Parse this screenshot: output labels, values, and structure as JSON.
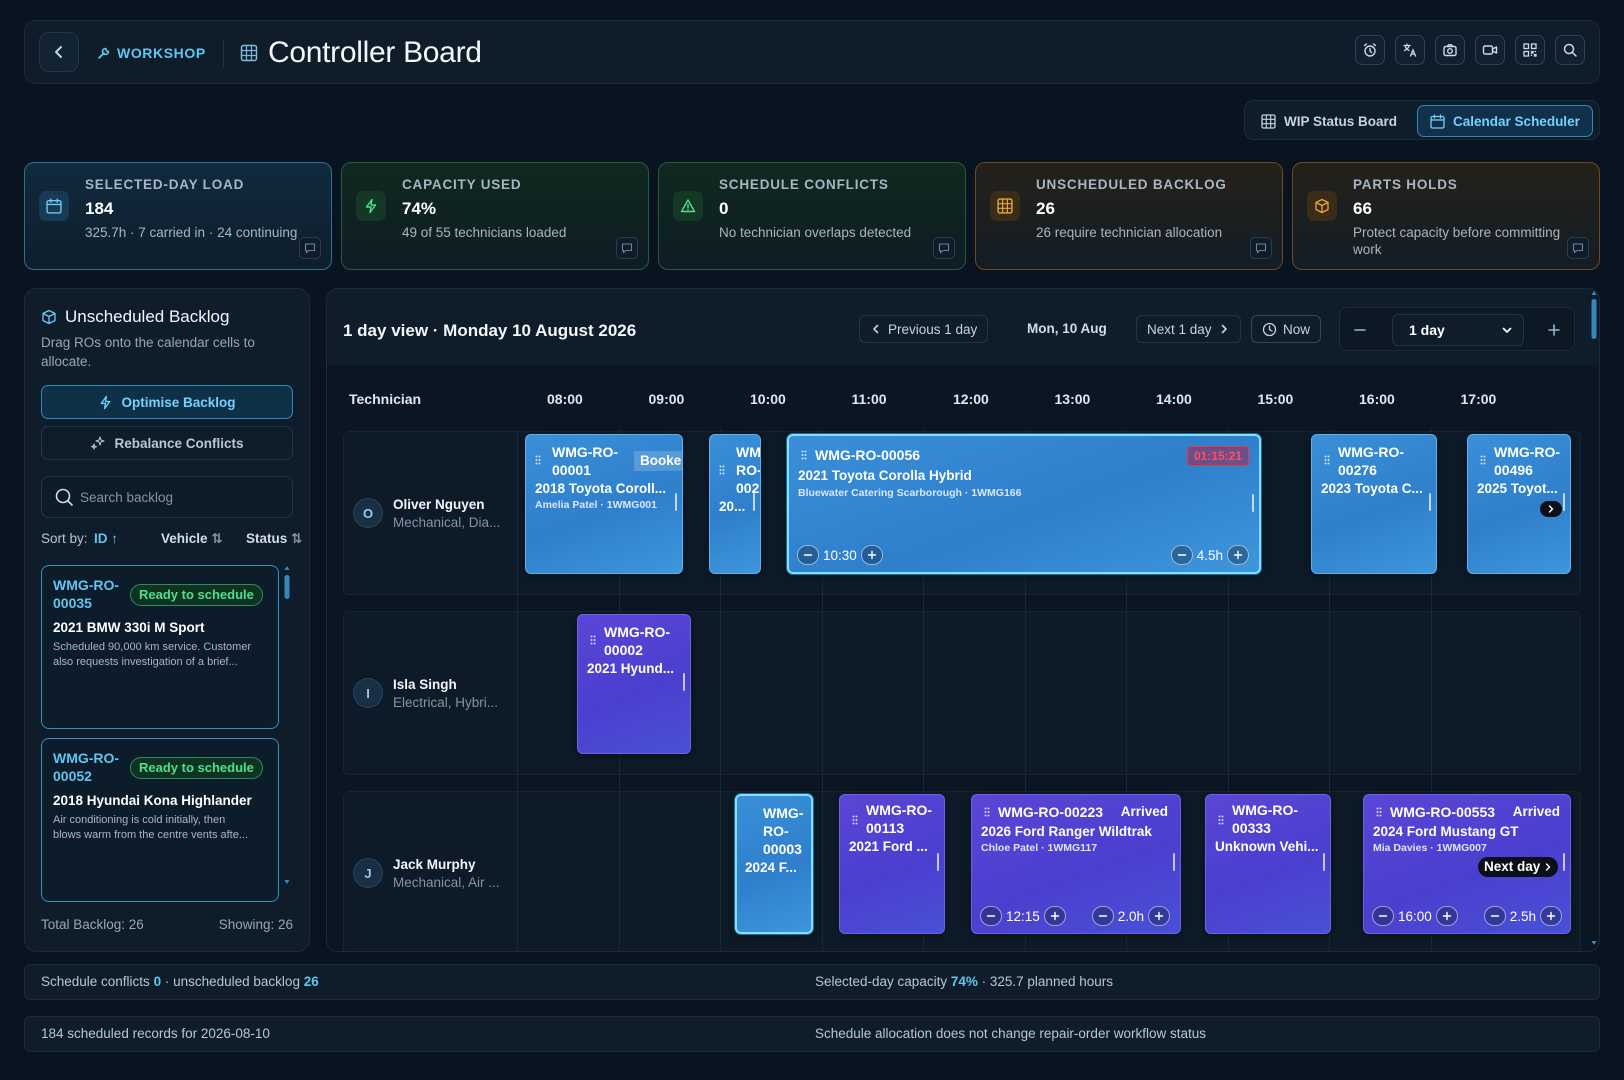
{
  "header": {
    "breadcrumb": "WORKSHOP",
    "title": "Controller Board"
  },
  "view_toggle": {
    "wip_label": "WIP Status Board",
    "calendar_label": "Calendar Scheduler",
    "active": "Calendar Scheduler"
  },
  "kpis": [
    {
      "label": "SELECTED-DAY LOAD",
      "value": "184",
      "sub": "325.7h · 7 carried in · 24 continuing",
      "color": "#2f89b9"
    },
    {
      "label": "CAPACITY USED",
      "value": "74%",
      "sub": "49 of 55 technicians loaded",
      "color": "#2c8e53"
    },
    {
      "label": "SCHEDULE CONFLICTS",
      "value": "0",
      "sub": "No technician overlaps detected",
      "color": "#2c8e53"
    },
    {
      "label": "UNSCHEDULED BACKLOG",
      "value": "26",
      "sub": "26 require technician allocation",
      "color": "#b07a2a"
    },
    {
      "label": "PARTS HOLDS",
      "value": "66",
      "sub": "Protect capacity before committing work",
      "color": "#b07a2a"
    }
  ],
  "backlog": {
    "title": "Unscheduled Backlog",
    "description": "Drag ROs onto the calendar cells to allocate.",
    "optimise_label": "Optimise Backlog",
    "rebalance_label": "Rebalance Conflicts",
    "search_placeholder": "Search backlog",
    "sort_label": "Sort by:",
    "sort_id": "ID",
    "sort_vehicle": "Vehicle",
    "sort_status": "Status",
    "cards": [
      {
        "id_line1": "WMG-RO-",
        "id_line2": "00035",
        "badge": "Ready to schedule",
        "vehicle": "2021 BMW 330i M Sport",
        "desc_line1": "Scheduled 90,000 km service. Customer",
        "desc_line2": "also requests investigation of a brief..."
      },
      {
        "id_line1": "WMG-RO-",
        "id_line2": "00052",
        "badge": "Ready to schedule",
        "vehicle": "2018 Hyundai Kona Highlander",
        "desc_line1": "Air conditioning is cold initially, then",
        "desc_line2": "blows warm from the centre vents afte..."
      }
    ],
    "total_label": "Total Backlog: 26",
    "showing_label": "Showing: 26"
  },
  "calendar": {
    "title": "1 day view · Monday 10 August 2026",
    "prev_label": "Previous 1 day",
    "current_date": "Mon, 10 Aug",
    "next_label": "Next 1 day",
    "now_label": "Now",
    "zoom_value": "1 day",
    "column_header": "Technician",
    "hours": [
      "08:00",
      "09:00",
      "10:00",
      "11:00",
      "12:00",
      "13:00",
      "14:00",
      "15:00",
      "16:00",
      "17:00"
    ],
    "technicians": [
      {
        "initial": "O",
        "name": "Oliver Nguyen",
        "role": "Mechanical, Dia..."
      },
      {
        "initial": "I",
        "name": "Isla Singh",
        "role": "Electrical, Hybri..."
      },
      {
        "initial": "J",
        "name": "Jack Murphy",
        "role": "Mechanical, Air ..."
      }
    ],
    "jobs": {
      "j1": {
        "l1": "WMG-RO-",
        "l2": "00001",
        "status": "Booke",
        "vehicle": "2018 Toyota Coroll...",
        "customer": "Amelia Patel · 1WMG001"
      },
      "j2": {
        "l1": "WM",
        "l2": "RO-",
        "l3": "002",
        "vehicle": "20..."
      },
      "j3": {
        "id": "WMG-RO-00056",
        "timer": "01:15:21",
        "vehicle": "2021 Toyota Corolla Hybrid",
        "customer": "Bluewater Catering Scarborough · 1WMG166",
        "start": "10:30",
        "duration": "4.5h"
      },
      "j4": {
        "l1": "WMG-RO-",
        "l2": "00276",
        "vehicle": "2023 Toyota C..."
      },
      "j5": {
        "l1": "WMG-RO-",
        "l2": "00496",
        "vehicle": "2025 Toyot..."
      },
      "j6": {
        "l1": "WMG-RO-",
        "l2": "00002",
        "vehicle": "2021 Hyund..."
      },
      "j7": {
        "l1": "WMG-",
        "l2": "RO-",
        "l3": "00003",
        "vehicle": "2024 F..."
      },
      "j8": {
        "l1": "WMG-RO-",
        "l2": "00113",
        "vehicle": "2021 Ford ..."
      },
      "j9": {
        "id": "WMG-RO-00223",
        "status": "Arrived",
        "vehicle": "2026 Ford Ranger Wildtrak",
        "customer": "Chloe Patel · 1WMG117",
        "start": "12:15",
        "duration": "2.0h"
      },
      "j10": {
        "l1": "WMG-RO-",
        "l2": "00333",
        "vehicle": "Unknown Vehi..."
      },
      "j11": {
        "id": "WMG-RO-00553",
        "status": "Arrived",
        "vehicle": "2024 Ford Mustang GT",
        "customer": "Mia Davies · 1WMG007",
        "next_day": "Next day",
        "start": "16:00",
        "duration": "2.5h"
      }
    }
  },
  "status_bar_1": {
    "conflicts_label": "Schedule conflicts",
    "conflicts_value": "0",
    "backlog_label": "· unscheduled backlog",
    "backlog_value": "26",
    "capacity_label": "Selected-day capacity",
    "capacity_value": "74%",
    "capacity_suffix": "· 325.7 planned hours"
  },
  "status_bar_2": {
    "left": "184 scheduled records for 2026-08-10",
    "right": "Schedule allocation does not change repair-order workflow status"
  }
}
